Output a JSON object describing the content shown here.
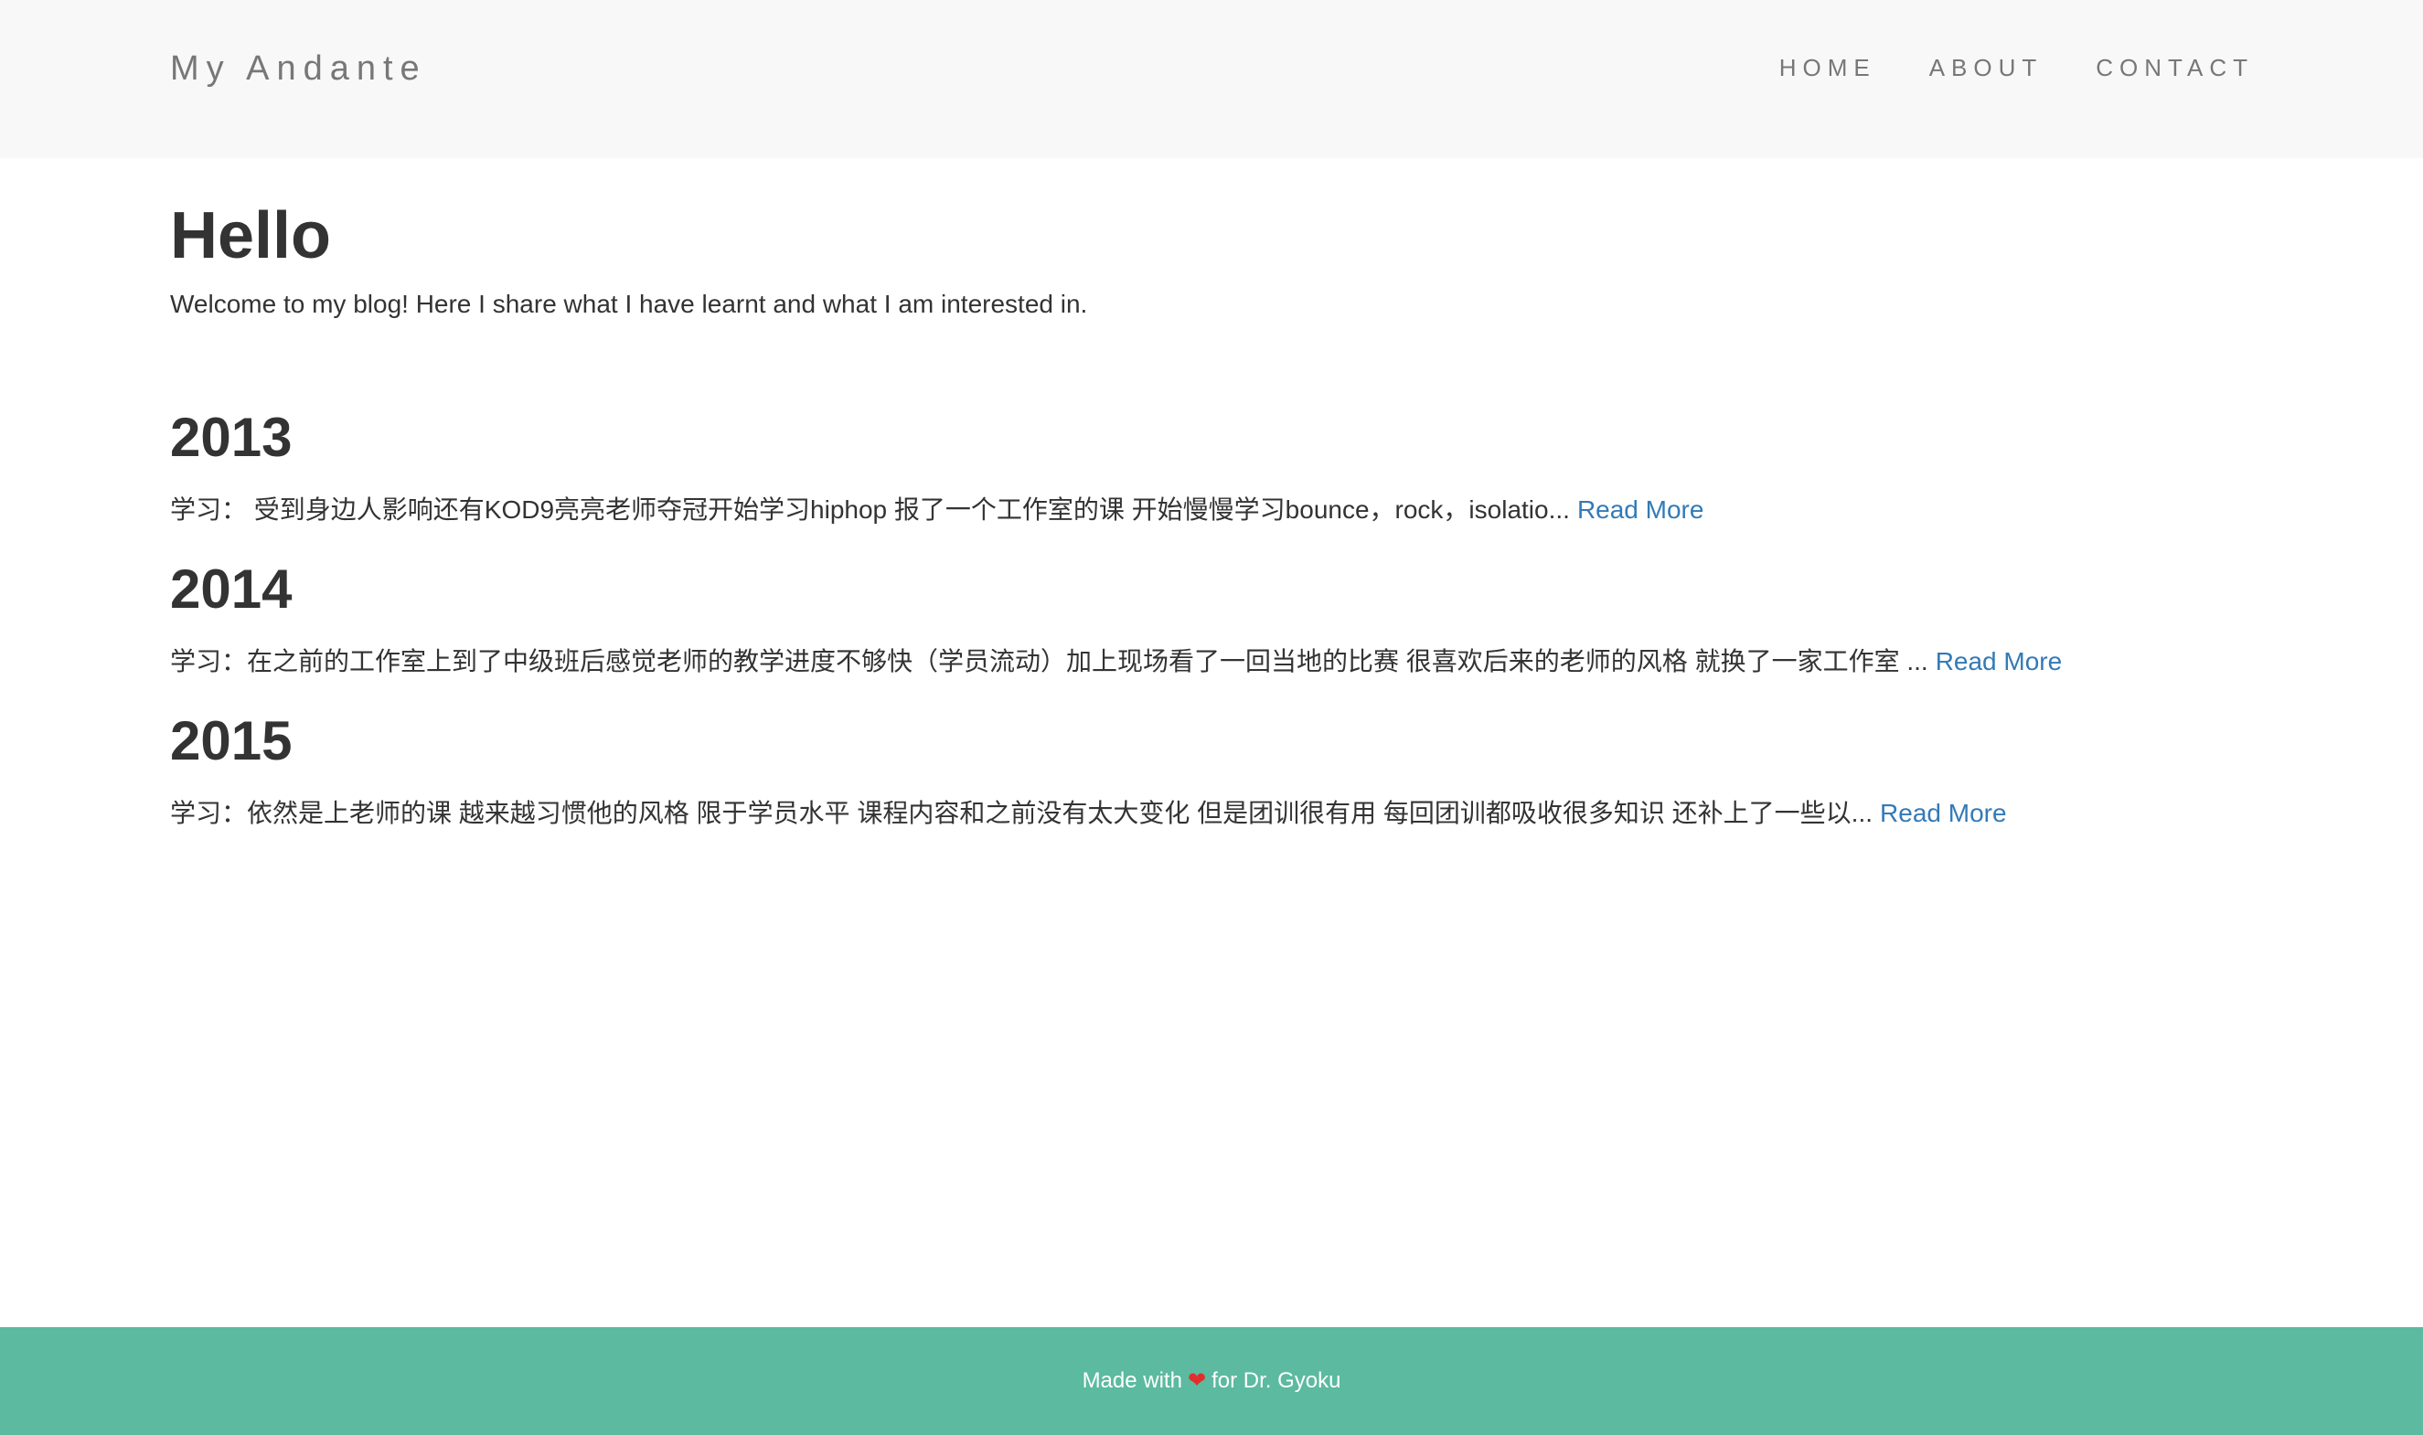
{
  "header": {
    "site_title": "My Andante",
    "nav": [
      {
        "label": "HOME"
      },
      {
        "label": "ABOUT"
      },
      {
        "label": "CONTACT"
      }
    ]
  },
  "hero": {
    "title": "Hello",
    "subtitle": "Welcome to my blog! Here I share what I have learnt and what I am interested in."
  },
  "posts": [
    {
      "title": "2013",
      "excerpt": "学习： 受到身边人影响还有KOD9亮亮老师夺冠开始学习hiphop 报了一个工作室的课 开始慢慢学习bounce，rock，isolatio...",
      "read_more": "Read More"
    },
    {
      "title": "2014",
      "excerpt": "学习：在之前的工作室上到了中级班后感觉老师的教学进度不够快（学员流动）加上现场看了一回当地的比赛 很喜欢后来的老师的风格 就换了一家工作室 ...",
      "read_more": "Read More"
    },
    {
      "title": "2015",
      "excerpt": "学习：依然是上老师的课 越来越习惯他的风格 限于学员水平 课程内容和之前没有太大变化 但是团训很有用 每回团训都吸收很多知识 还补上了一些以...",
      "read_more": "Read More"
    }
  ],
  "footer": {
    "text_before": "Made with",
    "heart_icon": "heart-icon",
    "text_after": "for Dr. Gyoku"
  },
  "colors": {
    "header_bg": "#f8f8f8",
    "footer_bg": "#5bba9f",
    "link": "#337ab7",
    "heart": "#e22d2d"
  }
}
